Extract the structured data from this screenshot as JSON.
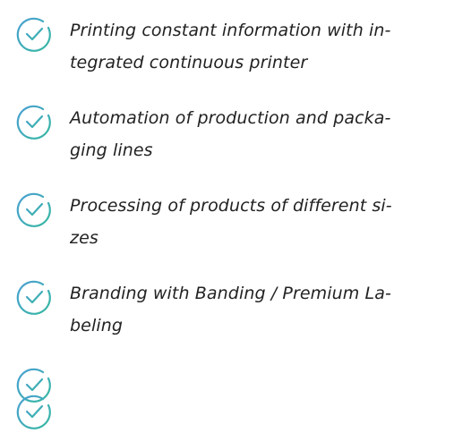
{
  "colors": {
    "icon_gradient_start": "#4a9fd4",
    "icon_gradient_end": "#36b8a0",
    "text": "#222222",
    "background": "#ffffff"
  },
  "icon": "check-circle-icon",
  "features": [
    {
      "lines": [
        "Printing constant information with in-",
        "tegrated continuous printer"
      ]
    },
    {
      "lines": [
        "Automation of production and packa-",
        "ging lines"
      ]
    },
    {
      "lines": [
        "Processing of products of different si-",
        "zes"
      ]
    },
    {
      "lines": [
        "Branding with Banding / Premium La-",
        "beling"
      ]
    }
  ]
}
